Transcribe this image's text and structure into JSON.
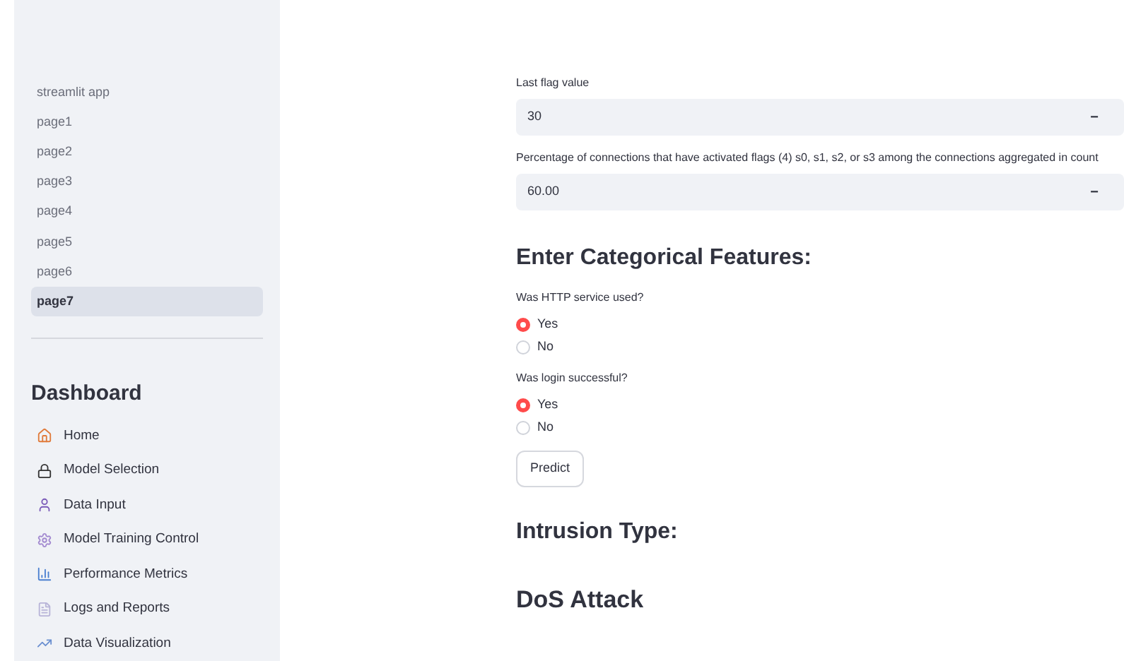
{
  "sidebar": {
    "pages": [
      {
        "label": "streamlit app",
        "selected": false
      },
      {
        "label": "page1",
        "selected": false
      },
      {
        "label": "page2",
        "selected": false
      },
      {
        "label": "page3",
        "selected": false
      },
      {
        "label": "page4",
        "selected": false
      },
      {
        "label": "page5",
        "selected": false
      },
      {
        "label": "page6",
        "selected": false
      },
      {
        "label": "page7",
        "selected": true
      }
    ],
    "dashboard": {
      "title": "Dashboard",
      "items": [
        {
          "label": "Home",
          "kind": "home"
        },
        {
          "label": "Model Selection",
          "kind": "lock"
        },
        {
          "label": "Data Input",
          "kind": "person"
        },
        {
          "label": "Model Training Control",
          "kind": "gear"
        },
        {
          "label": "Performance Metrics",
          "kind": "chart"
        },
        {
          "label": "Logs and Reports",
          "kind": "document"
        },
        {
          "label": "Data Visualization",
          "kind": "trend"
        }
      ]
    }
  },
  "main": {
    "number_inputs": [
      {
        "label": "Last flag value",
        "value": "30",
        "minus": "−"
      },
      {
        "label": "Percentage of connections that have activated flags (4) s0, s1, s2, or s3 among the connections aggregated in count",
        "value": "60.00",
        "minus": "−"
      }
    ],
    "categorical_heading": "Enter Categorical Features:",
    "radio_groups": [
      {
        "label": "Was HTTP service used?",
        "options": [
          {
            "label": "Yes",
            "selected": true
          },
          {
            "label": "No",
            "selected": false
          }
        ]
      },
      {
        "label": "Was login successful?",
        "options": [
          {
            "label": "Yes",
            "selected": true
          },
          {
            "label": "No",
            "selected": false
          }
        ]
      }
    ],
    "button": "Predict",
    "result_heading": "Intrusion Type:",
    "result": "DoS Attack"
  }
}
